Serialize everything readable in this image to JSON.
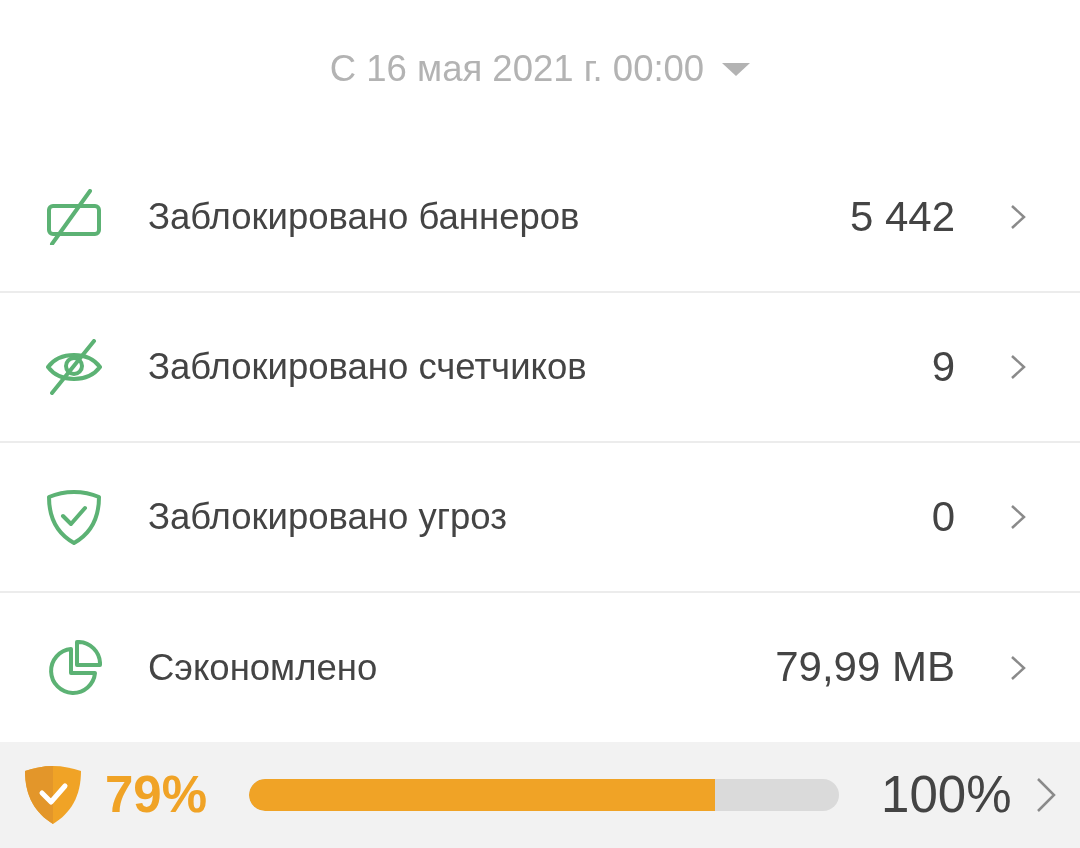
{
  "date_filter": {
    "label": "С 16 мая 2021 г. 00:00"
  },
  "stats": [
    {
      "kind": "banners",
      "label": "Заблокировано баннеров",
      "value": "5 442"
    },
    {
      "kind": "trackers",
      "label": "Заблокировано счетчиков",
      "value": "9"
    },
    {
      "kind": "threats",
      "label": "Заблокировано угроз",
      "value": "0"
    },
    {
      "kind": "saved",
      "label": "Сэкономлено",
      "value": "79,99 MB"
    }
  ],
  "protection": {
    "percent": "79%",
    "level": 0.79,
    "max_label": "100%"
  }
}
